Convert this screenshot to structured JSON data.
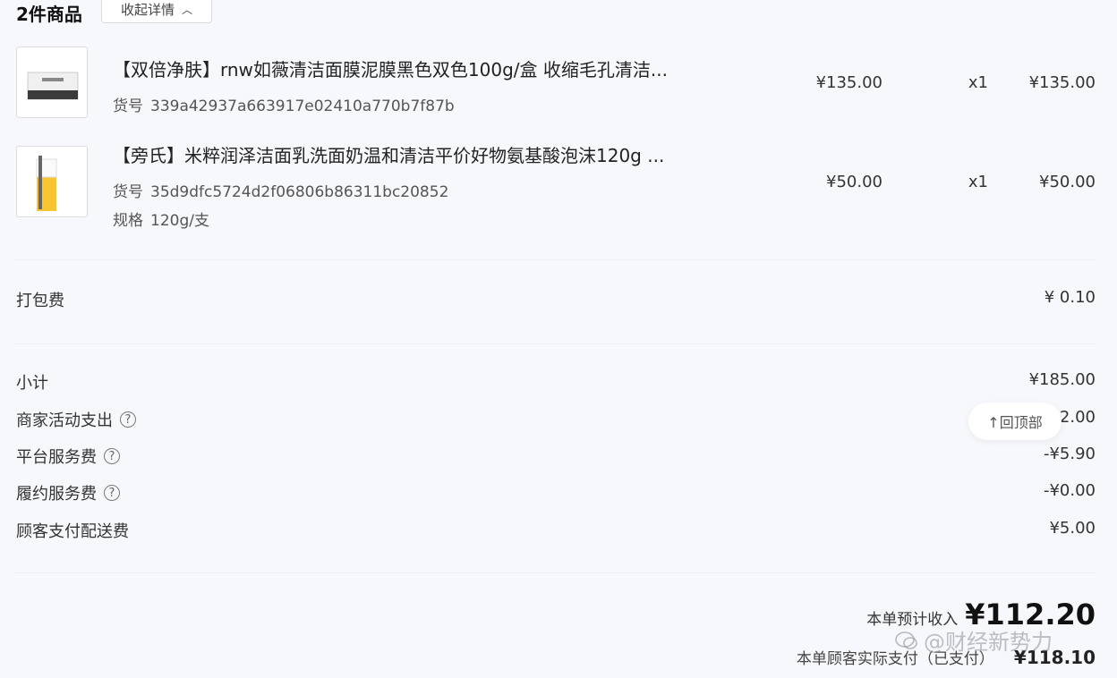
{
  "header": {
    "title": "2件商品",
    "collapse_label": "收起详情"
  },
  "products": [
    {
      "name": "【双倍净肤】rnw如薇清洁面膜泥膜黑色双色100g/盒 收缩毛孔清洁...",
      "sku_label": "货号",
      "sku": "339a42937a663917e02410a770b7f87b",
      "unit_price": "¥135.00",
      "qty": "x1",
      "total": "¥135.00"
    },
    {
      "name": "【旁氏】米粹润泽洁面乳洗面奶温和清洁平价好物氨基酸泡沫120g ...",
      "sku_label": "货号",
      "sku": "35d9dfc5724d2f06806b86311bc20852",
      "spec_label": "规格",
      "spec": "120g/支",
      "unit_price": "¥50.00",
      "qty": "x1",
      "total": "¥50.00"
    }
  ],
  "packing": {
    "label": "打包费",
    "value": "¥ 0.10"
  },
  "fees": [
    {
      "label": "小计",
      "value": "¥185.00"
    },
    {
      "label": "商家活动支出",
      "value": "2.00"
    },
    {
      "label": "平台服务费",
      "value": "-¥5.90"
    },
    {
      "label": "履约服务费",
      "value": "-¥0.00"
    },
    {
      "label": "顾客支付配送费",
      "value": "¥5.00"
    }
  ],
  "back_to_top": "↑回顶部",
  "summary": {
    "income_label": "本单预计收入",
    "income_value": "¥112.20",
    "paid_label": "本单顾客实际支付（已支付）",
    "paid_value": "¥118.10"
  },
  "watermark": "@财经新势力",
  "colors": {
    "background": "#f7f8fc",
    "text": "#222222",
    "divider": "#eceef4"
  }
}
